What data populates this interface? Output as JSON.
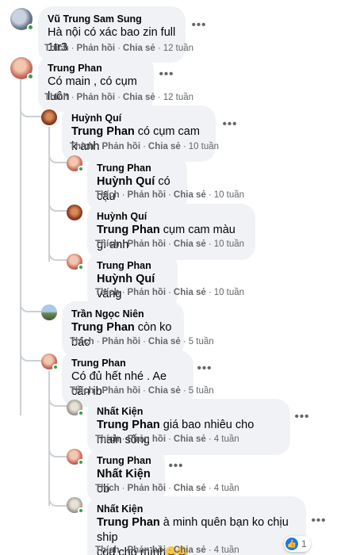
{
  "actions": {
    "like": "Thích",
    "reply": "Phản hồi",
    "share": "Chia sẻ"
  },
  "more_glyph": "•••",
  "comments": [
    {
      "author": "Vũ Trung Sam Sung",
      "text": "Hà nội có xác bao zin full 1tr3",
      "time": "12 tuần"
    },
    {
      "author": "Trung Phan",
      "text": "Có main , có cụm luôn",
      "time": "12 tuần"
    },
    {
      "author": "Huỳnh Quí",
      "mention": "Trung Phan",
      "text": " có cụm cam k anh",
      "time": "10 tuần"
    },
    {
      "author": "Trung Phan",
      "mention": "Huỳnh Quí",
      "text": " có cậu",
      "time": "10 tuần"
    },
    {
      "author": "Huỳnh Quí",
      "mention": "Trung Phan",
      "text": " cụm cam màu gì anh",
      "time": "10 tuần"
    },
    {
      "author": "Trung Phan",
      "mention": "Huỳnh Quí",
      "text": " vàng",
      "time": "10 tuần"
    },
    {
      "author": "Trần Ngọc Niên",
      "mention": "Trung Phan",
      "text": " còn ko bác",
      "time": "5 tuần"
    },
    {
      "author": "Trung Phan",
      "text": "Có đủ hết nhé . Ae cần ib",
      "time": "5 tuần"
    },
    {
      "author": "Nhất Kiện",
      "mention": "Trung Phan",
      "text": " giá bao nhiêu cho main sống",
      "time": "4 tuần"
    },
    {
      "author": "Trung Phan",
      "mention": "Nhất Kiện",
      "text": " ob",
      "time": "4 tuần"
    },
    {
      "author": "Nhất Kiện",
      "mention": "Trung Phan",
      "text": " à minh quên bạn ko chịu ship",
      "text2": "cod cho mình",
      "time": "4 tuần",
      "reaction": {
        "icon": "like-icon",
        "count": "1"
      }
    }
  ],
  "colors": {
    "bubble": "#f0f2f5",
    "meta": "#65676b",
    "online": "#31a24c",
    "like": "#1877f2"
  }
}
